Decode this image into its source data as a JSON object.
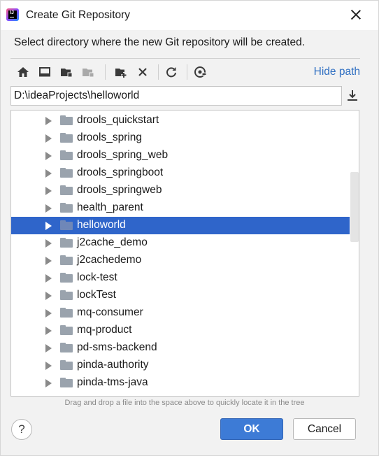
{
  "window": {
    "title": "Create Git Repository",
    "app_icon_text": "IJ"
  },
  "description": "Select directory where the new Git repository will be created.",
  "toolbar": {
    "buttons": [
      "home-icon",
      "desktop-icon",
      "project-folder-icon",
      "module-folder-icon",
      "new-folder-icon",
      "delete-icon",
      "refresh-icon",
      "show-hidden-icon"
    ],
    "hide_path_label": "Hide path"
  },
  "path": {
    "value": "D:\\ideaProjects\\helloworld"
  },
  "tree": {
    "items": [
      {
        "label": "drools_quickstart",
        "selected": false
      },
      {
        "label": "drools_spring",
        "selected": false
      },
      {
        "label": "drools_spring_web",
        "selected": false
      },
      {
        "label": "drools_springboot",
        "selected": false
      },
      {
        "label": "drools_springweb",
        "selected": false
      },
      {
        "label": "health_parent",
        "selected": false
      },
      {
        "label": "helloworld",
        "selected": true
      },
      {
        "label": "j2cache_demo",
        "selected": false
      },
      {
        "label": "j2cachedemo",
        "selected": false
      },
      {
        "label": "lock-test",
        "selected": false
      },
      {
        "label": "lockTest",
        "selected": false
      },
      {
        "label": "mq-consumer",
        "selected": false
      },
      {
        "label": "mq-product",
        "selected": false
      },
      {
        "label": "pd-sms-backend",
        "selected": false
      },
      {
        "label": "pinda-authority",
        "selected": false
      },
      {
        "label": "pinda-tms-java",
        "selected": false
      }
    ]
  },
  "hint": "Drag and drop a file into the space above to quickly locate it in the tree",
  "footer": {
    "help_label": "?",
    "ok_label": "OK",
    "cancel_label": "Cancel"
  },
  "colors": {
    "selection": "#2f65ca",
    "ok_button": "#3d7bd6",
    "link": "#2f6fc2"
  }
}
